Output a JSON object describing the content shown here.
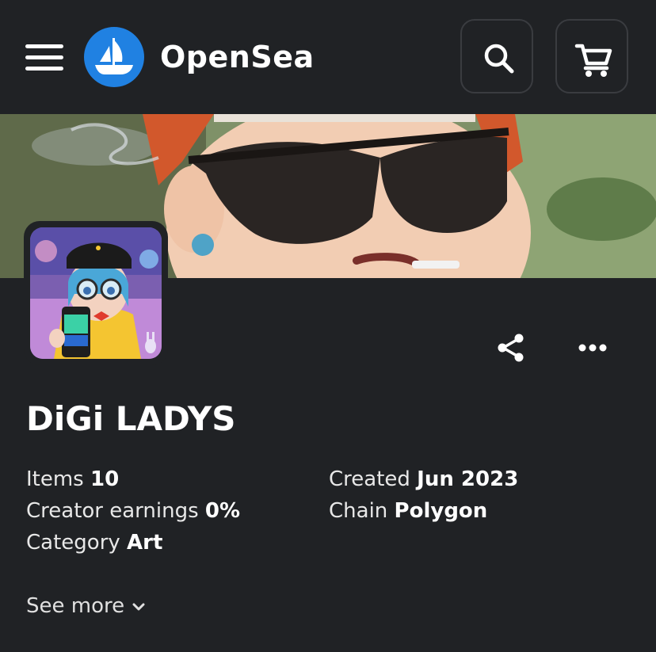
{
  "header": {
    "brand_name": "OpenSea",
    "menu_icon": "hamburger-menu-icon",
    "logo_icon": "opensea-ship-logo",
    "search_icon": "search-icon",
    "cart_icon": "shopping-cart-icon",
    "brand_color": "#2081e2"
  },
  "collection": {
    "name": "DiGi LADYS",
    "share_icon": "share-icon",
    "more_icon": "more-dots-icon",
    "details": {
      "items_label": "Items",
      "items_value": "10",
      "creator_earnings_label": "Creator earnings",
      "creator_earnings_value": "0%",
      "category_label": "Category",
      "category_value": "Art",
      "created_label": "Created",
      "created_value": "Jun 2023",
      "chain_label": "Chain",
      "chain_value": "Polygon"
    },
    "see_more_label": "See more",
    "see_more_icon": "chevron-down-icon"
  },
  "colors": {
    "background": "#202225",
    "text": "#ffffff",
    "button_border": "#3a3c40"
  }
}
